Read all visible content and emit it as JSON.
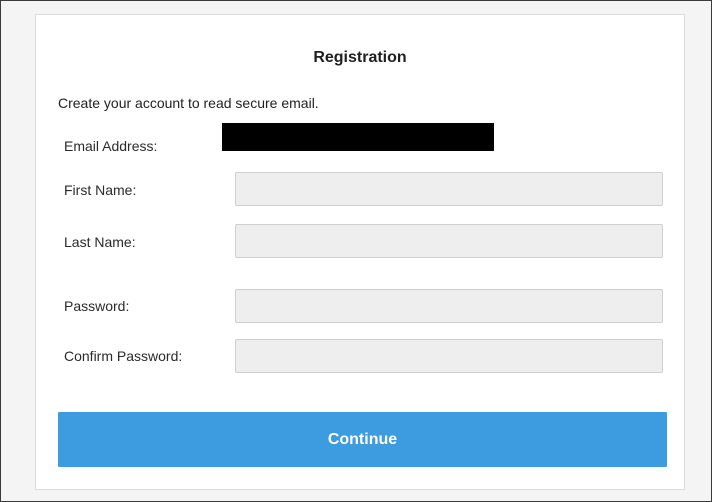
{
  "form": {
    "title": "Registration",
    "subtitle": "Create your account to read secure email.",
    "fields": {
      "email_label": "Email Address:",
      "first_name_label": "First Name:",
      "last_name_label": "Last Name:",
      "password_label": "Password:",
      "confirm_password_label": "Confirm Password:"
    },
    "values": {
      "first_name": "",
      "last_name": "",
      "password": "",
      "confirm_password": ""
    },
    "continue_label": "Continue"
  },
  "colors": {
    "button": "#3d9be0",
    "input_background": "#eeeeee",
    "redaction": "#000000"
  }
}
